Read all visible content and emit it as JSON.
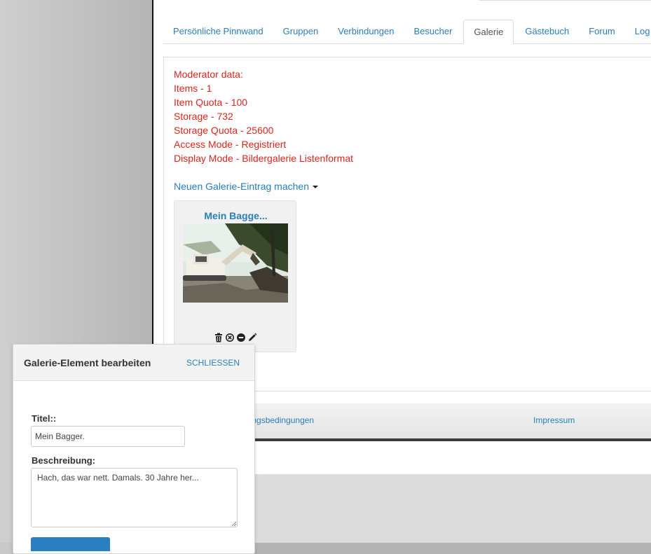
{
  "tabs": [
    {
      "label": "Persönliche Pinnwand"
    },
    {
      "label": "Gruppen"
    },
    {
      "label": "Verbindungen"
    },
    {
      "label": "Besucher"
    },
    {
      "label": "Galerie",
      "active": true
    },
    {
      "label": "Gästebuch"
    },
    {
      "label": "Forum"
    },
    {
      "label": "Log"
    }
  ],
  "moderator": {
    "lines": [
      "Moderator data:",
      "Items - 1",
      "Item Quota - 100",
      "Storage - 732",
      "Storage Quota - 25600",
      "Access Mode - Registriert",
      "Display Mode - Bildergalerie Listenformat"
    ]
  },
  "new_entry_label": "Neuen Galerie-Eintrag machen",
  "gallery_item": {
    "title": "Mein Bagge...",
    "actions": [
      "trash-icon",
      "cancel-circle-icon",
      "minus-circle-icon",
      "pencil-icon"
    ]
  },
  "footer": {
    "terms_label": "Nutzungsbedingungen",
    "imprint_label": "Impressum"
  },
  "modal": {
    "title": "Galerie-Element bearbeiten",
    "close_label": "SCHLIESSEN",
    "title_field_label": "Titel::",
    "title_value": "Mein Bagger.",
    "desc_field_label": "Beschreibung:",
    "desc_value": "Hach, das war nett. Damals. 30 Jahre her..."
  },
  "colors": {
    "link": "#2a7fb8",
    "moderator_text": "#d9261c",
    "button": "#2a7fc1"
  }
}
